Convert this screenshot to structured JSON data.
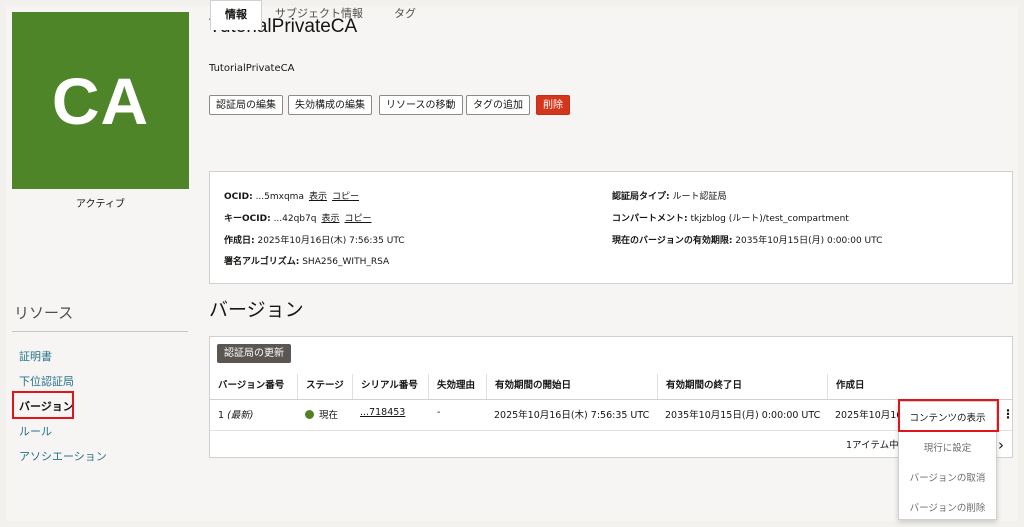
{
  "ca": {
    "tile_text": "CA",
    "status": "アクティブ",
    "tile_color": "#4f8529"
  },
  "resources": {
    "title": "リソース",
    "items": [
      {
        "label": "証明書"
      },
      {
        "label": "下位認証局"
      },
      {
        "label": "バージョン"
      },
      {
        "label": "ルール"
      },
      {
        "label": "アソシエーション"
      }
    ],
    "active_index": 2
  },
  "header": {
    "title": "TutorialPrivateCA",
    "subtitle": "TutorialPrivateCA",
    "actions": [
      "認証局の編集",
      "失効構成の編集",
      "リソースの移動",
      "タグの追加",
      "削除"
    ]
  },
  "tabs": [
    "情報",
    "サブジェクト情報",
    "タグ"
  ],
  "info": {
    "ocid_label": "OCID:",
    "ocid_value": "...5mxqma",
    "key_ocid_label": "キーOCID:",
    "key_ocid_value": "...42qb7q",
    "show_link": "表示",
    "copy_link": "コピー",
    "created_label": "作成日:",
    "created_value": "2025年10月16日(木) 7:56:35 UTC",
    "sig_label": "署名アルゴリズム:",
    "sig_value": "SHA256_WITH_RSA",
    "type_label": "認証局タイプ:",
    "type_value": "ルート認証局",
    "compartment_label": "コンパートメント:",
    "compartment_value": "tkjzblog (ルート)/test_compartment",
    "validity_label": "現在のバージョンの有効期限:",
    "validity_value": "2035年10月15日(月) 0:00:00 UTC"
  },
  "versions": {
    "title": "バージョン",
    "rotate_button": "認証局の更新",
    "columns": [
      "バージョン番号",
      "ステージ",
      "シリアル番号",
      "失効理由",
      "有効期間の開始日",
      "有効期間の終了日",
      "作成日"
    ],
    "row": {
      "number": "1",
      "latest": "(最新)",
      "stage": "現在",
      "serial": "...718453",
      "revocation": "-",
      "valid_from": "2025年10月16日(木) 7:56:35 UTC",
      "valid_to": "2035年10月15日(月) 0:00:00 UTC",
      "created": "2025年10月16"
    },
    "pager": "1アイテム中"
  },
  "context_menu": {
    "items": [
      "コンテンツの表示",
      "現行に設定",
      "バージョンの取消",
      "バージョンの削除"
    ]
  },
  "colors": {
    "accent_link": "#25738a",
    "danger": "#d4361b",
    "highlight": "#e0141e"
  }
}
